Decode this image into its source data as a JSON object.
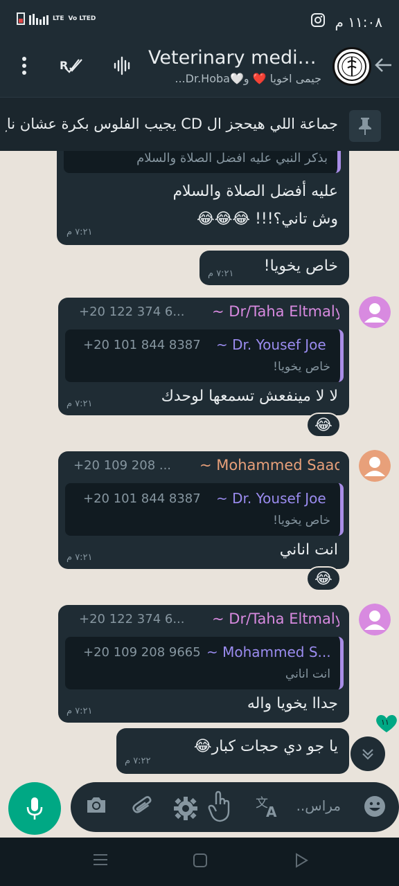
{
  "status": {
    "time": "١١:٠٨ م",
    "network": "LTE",
    "volte": "Vo LTED"
  },
  "header": {
    "title": "Veterinary medici...",
    "subtitle": "جيمى اخويا ❤️ و🤍Dr.Hoba..."
  },
  "pinned": {
    "text": "جماعة اللي هيحجز ال CD يجيب الفلوس بكرة عشان ناخ..."
  },
  "messages": {
    "m1": {
      "quote_text": "بذكر النبي عليه افضل الصلاة والسلام",
      "line1": "عليه أفضل الصلاة والسلام",
      "line2": "وش تاني؟!!! 😂😂😂",
      "time": "٧:٢١ م"
    },
    "m2": {
      "text": "خاص يخويا!",
      "time": "٧:٢١ م"
    },
    "m3": {
      "sender": "~ Dr/Taha Eltmaly",
      "sender_phone": "+20 122 374 6...",
      "quote_name": "~ Dr. Yousef Joe",
      "quote_phone": "+20 101 844 8387",
      "quote_text": "خاص يخويا!",
      "text": "لا لا مينفعش تسمعها لوحدك",
      "time": "٧:٢١ م",
      "reaction": "😂"
    },
    "m4": {
      "sender": "~ Mohammed Saad",
      "sender_phone": "+20 109 208 ...",
      "quote_name": "~ Dr. Yousef Joe",
      "quote_phone": "+20 101 844 8387",
      "quote_text": "خاص يخويا!",
      "text": "انت اناني",
      "time": "٧:٢١ م",
      "reaction": "😂"
    },
    "m5": {
      "sender": "~ Dr/Taha Eltmaly",
      "sender_phone": "+20 122 374 6...",
      "quote_name": "~ Mohammed S...",
      "quote_phone": "+20 109 208 9665",
      "quote_text": "انت اناني",
      "text": "جداا يخويا واله",
      "time": "٧:٢١ م"
    },
    "m6": {
      "text": "يا جو دي حجات كبار😂",
      "time": "٧:٢٢ م"
    }
  },
  "unread_count": "١١",
  "input": {
    "placeholder": "مراس.."
  },
  "colors": {
    "accent": "#00a884",
    "bubble": "#1f2c34",
    "header": "#1f2c34",
    "taha_name": "#d88ae0",
    "saad_name": "#e8a07a",
    "quote_bar": "#a88de6"
  },
  "icons": [
    "back-arrow-icon",
    "group-avatar",
    "voice-wave-icon",
    "rx-checks-icon",
    "more-vert-icon",
    "pin-icon",
    "camera-icon",
    "attach-icon",
    "settings-icon",
    "touch-icon",
    "translate-icon",
    "emoji-icon",
    "mic-icon",
    "chevron-double-down-icon",
    "menu-nav-icon",
    "home-nav-icon",
    "back-nav-icon"
  ]
}
